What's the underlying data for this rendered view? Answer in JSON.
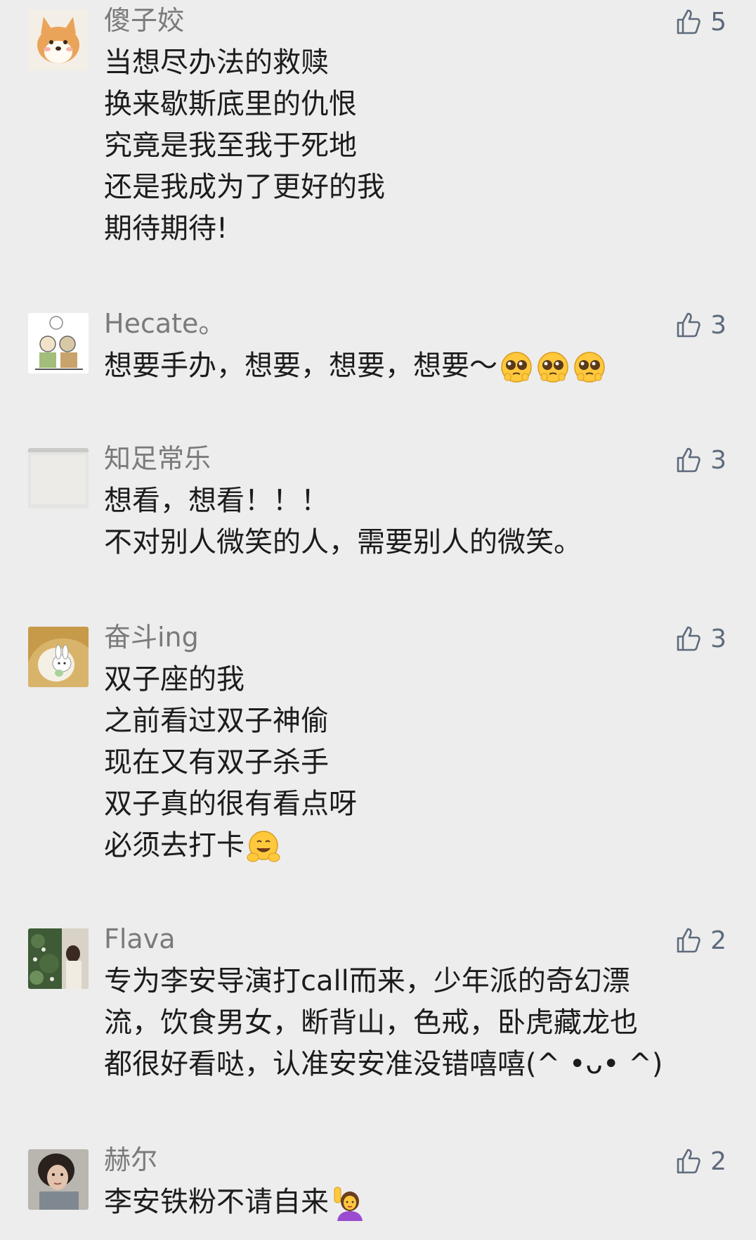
{
  "comments": [
    {
      "name": "傻子姣",
      "likes": "5",
      "avatar": "shiba-dog-avatar",
      "lines": [
        "当想尽办法的救赎",
        "换来歇斯底里的仇恨",
        "究竟是我至我于死地",
        "还是我成为了更好的我",
        "期待期待!"
      ]
    },
    {
      "name": "Hecate。",
      "likes": "3",
      "avatar": "cartoon-sketch-avatar",
      "lines": [
        "想要手办，想要，想要，想要～"
      ],
      "emojis": [
        "pleading-face-emoji",
        "pleading-face-emoji",
        "pleading-face-emoji"
      ]
    },
    {
      "name": "知足常乐",
      "likes": "3",
      "avatar": "blank-screen-avatar",
      "lines": [
        "想看，想看！！！",
        "不对别人微笑的人，需要别人的微笑。"
      ]
    },
    {
      "name": "奋斗ing",
      "likes": "3",
      "avatar": "bunny-avatar",
      "lines": [
        "双子座的我",
        "之前看过双子神偷",
        "现在又有双子杀手",
        "双子真的很有看点呀",
        "必须去打卡"
      ],
      "emojis": [
        "hugging-face-emoji"
      ]
    },
    {
      "name": "Flava",
      "likes": "2",
      "avatar": "photo-avatar",
      "lines": [
        "专为李安导演打call而来，少年派的奇幻漂",
        "流，饮食男女，断背山，色戒，卧虎藏龙也",
        "都很好看哒，认准安安准没错嘻嘻(^ •ᴗ• ^)"
      ]
    },
    {
      "name": "赫尔",
      "likes": "2",
      "avatar": "portrait-avatar",
      "lines": [
        "李安铁粉不请自来"
      ],
      "emojis": [
        "person-raising-hand-emoji"
      ]
    }
  ],
  "colors": {
    "background": "#ededed",
    "name": "#7a7a7a",
    "text": "#1c1c1c",
    "like": "#5e6a7c"
  },
  "icons": {
    "like": "thumbs-up-icon"
  }
}
